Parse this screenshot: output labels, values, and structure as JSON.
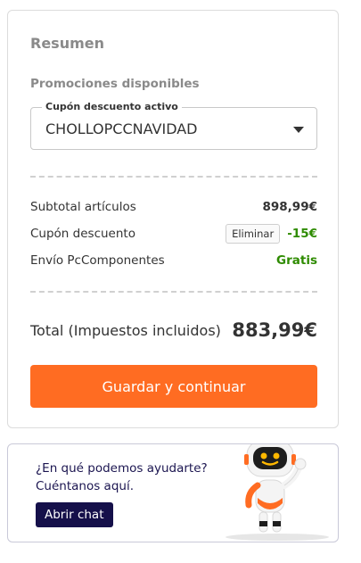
{
  "summary": {
    "title": "Resumen",
    "promotions_label": "Promociones disponibles",
    "coupon_select": {
      "legend": "Cupón descuento activo",
      "selected": "CHOLLOPCCNAVIDAD"
    },
    "rows": [
      {
        "label": "Subtotal artículos",
        "value": "898,99€"
      },
      {
        "label": "Cupón descuento",
        "value": "-15€",
        "button": "Eliminar"
      },
      {
        "label": "Envío PcComponentes",
        "value": "Gratis"
      }
    ],
    "total_label": "Total (Impuestos incluidos)",
    "total_value": "883,99€",
    "continue_button": "Guardar y continuar"
  },
  "help": {
    "question": "¿En qué podemos ayudarte?",
    "prompt": "Cuéntanos aquí.",
    "chat_button": "Abrir chat"
  },
  "colors": {
    "accent": "#ff6c22",
    "discount_green": "#2e8b00",
    "chat_navy": "#15104a",
    "muted_heading": "#8a8a8a"
  },
  "icons": [
    "chevron-down-icon",
    "robot-mascot"
  ]
}
